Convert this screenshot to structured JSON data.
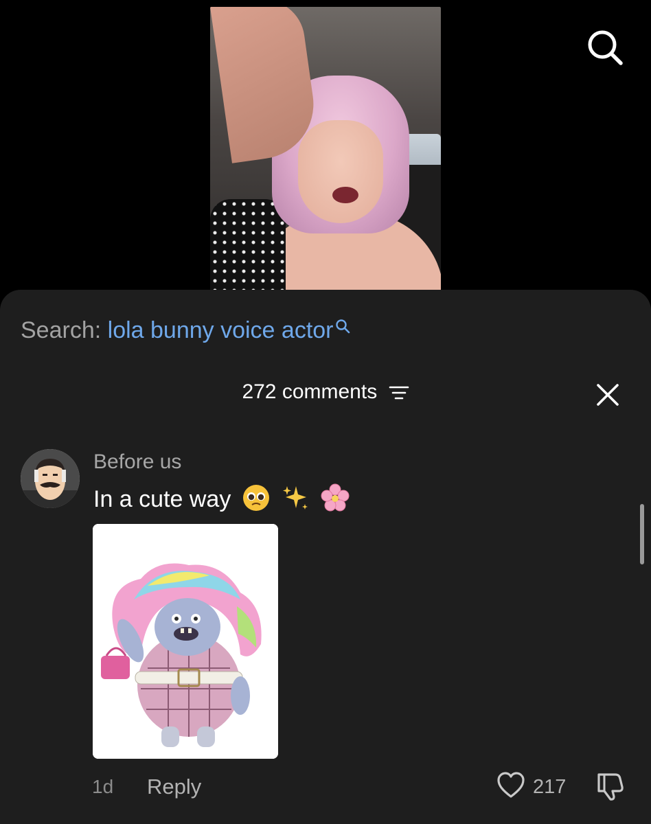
{
  "video": {
    "description_icon": "video-preview"
  },
  "top_bar": {
    "search_icon": "search-icon"
  },
  "search": {
    "label": "Search:",
    "query": "lola bunny voice actor"
  },
  "comments_header": {
    "count_label": "272 comments",
    "filter_icon": "filter-icon",
    "close_icon": "close-icon"
  },
  "comment": {
    "username": "Before us",
    "text": "In a cute way",
    "emojis": [
      "pleading-face-emoji",
      "sparkles-emoji",
      "cherry-blossom-emoji"
    ],
    "time": "1d",
    "reply_label": "Reply",
    "like_count": "217"
  },
  "colors": {
    "sheet_bg": "#1e1e1e",
    "link_blue": "#6fa8ea",
    "muted_text": "#a7a7a7"
  }
}
